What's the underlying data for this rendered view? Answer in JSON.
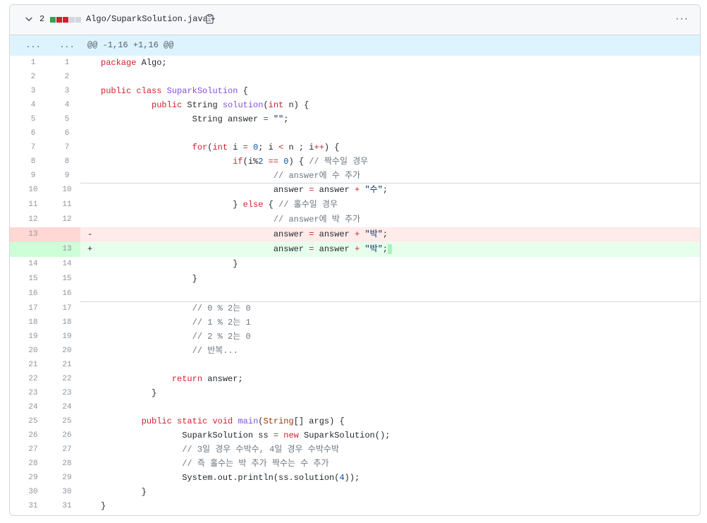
{
  "file_header": {
    "change_count": "2",
    "path": "Algo/SuparkSolution.java",
    "diffstat_colors": [
      "#2da44e",
      "#cf222e",
      "#cf222e",
      "#d0d7de",
      "#d0d7de"
    ],
    "icons": {
      "collapse": "chevron-down-icon",
      "copy": "copy-icon",
      "menu": "kebab-horizontal-icon"
    },
    "menu_label": "···"
  },
  "hunk": {
    "expand_left": "...",
    "expand_right": "...",
    "header": "@@ -1,16 +1,16 @@"
  },
  "colors": {
    "deleted_bg": "#ffebe9",
    "added_bg": "#e6ffec",
    "hunk_bg": "#ddf4ff"
  },
  "lines": [
    {
      "old": "1",
      "new": "1",
      "type": "ctx",
      "code": "package Algo;"
    },
    {
      "old": "2",
      "new": "2",
      "type": "ctx",
      "code": ""
    },
    {
      "old": "3",
      "new": "3",
      "type": "ctx",
      "code": "public class SuparkSolution {"
    },
    {
      "old": "4",
      "new": "4",
      "type": "ctx",
      "code": "          public String solution(int n) {"
    },
    {
      "old": "5",
      "new": "5",
      "type": "ctx",
      "code": "                  String answer = \"\";"
    },
    {
      "old": "6",
      "new": "6",
      "type": "ctx",
      "code": ""
    },
    {
      "old": "7",
      "new": "7",
      "type": "ctx",
      "code": "                  for(int i = 0; i < n ; i++) {"
    },
    {
      "old": "8",
      "new": "8",
      "type": "ctx",
      "code": "                          if(i%2 == 0) { // 짝수일 경우"
    },
    {
      "old": "9",
      "new": "9",
      "type": "ctx",
      "code": "                                  // answer에 수 추가"
    },
    {
      "old": "10",
      "new": "10",
      "type": "ctx",
      "code": "                                  answer = answer + \"수\";"
    },
    {
      "old": "11",
      "new": "11",
      "type": "ctx",
      "code": "                          } else { // 홀수일 경우"
    },
    {
      "old": "12",
      "new": "12",
      "type": "ctx",
      "code": "                                  // answer에 박 추가"
    },
    {
      "old": "13",
      "new": "",
      "type": "del",
      "marker": "-",
      "code": "                                  answer = answer + \"박\";"
    },
    {
      "old": "",
      "new": "13",
      "type": "add",
      "marker": "+",
      "code": "                                  answer = answer + \"박\";"
    },
    {
      "old": "14",
      "new": "14",
      "type": "ctx",
      "code": "                          }"
    },
    {
      "old": "15",
      "new": "15",
      "type": "ctx",
      "code": "                  }"
    },
    {
      "old": "16",
      "new": "16",
      "type": "ctx",
      "code": ""
    },
    {
      "old": "17",
      "new": "17",
      "type": "ctx",
      "code": "                  // 0 % 2는 0"
    },
    {
      "old": "18",
      "new": "18",
      "type": "ctx",
      "code": "                  // 1 % 2는 1"
    },
    {
      "old": "19",
      "new": "19",
      "type": "ctx",
      "code": "                  // 2 % 2는 0"
    },
    {
      "old": "20",
      "new": "20",
      "type": "ctx",
      "code": "                  // 반복..."
    },
    {
      "old": "21",
      "new": "21",
      "type": "ctx",
      "code": ""
    },
    {
      "old": "22",
      "new": "22",
      "type": "ctx",
      "code": "              return answer;"
    },
    {
      "old": "23",
      "new": "23",
      "type": "ctx",
      "code": "          }"
    },
    {
      "old": "24",
      "new": "24",
      "type": "ctx",
      "code": ""
    },
    {
      "old": "25",
      "new": "25",
      "type": "ctx",
      "code": "        public static void main(String[] args) {"
    },
    {
      "old": "26",
      "new": "26",
      "type": "ctx",
      "code": "                SuparkSolution ss = new SuparkSolution();"
    },
    {
      "old": "27",
      "new": "27",
      "type": "ctx",
      "code": "                // 3일 경우 수박수, 4일 경우 수박수박"
    },
    {
      "old": "28",
      "new": "28",
      "type": "ctx",
      "code": "                // 즉 홀수는 박 추가 짝수는 수 추가"
    },
    {
      "old": "29",
      "new": "29",
      "type": "ctx",
      "code": "                System.out.println(ss.solution(4));"
    },
    {
      "old": "30",
      "new": "30",
      "type": "ctx",
      "code": "        }"
    },
    {
      "old": "31",
      "new": "31",
      "type": "ctx",
      "code": "}"
    }
  ]
}
